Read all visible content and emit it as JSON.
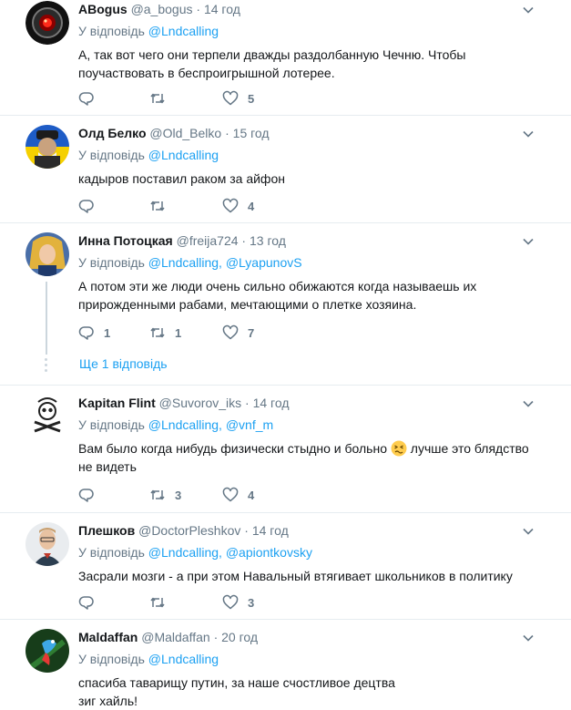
{
  "colors": {
    "link": "#1da1f2",
    "muted": "#657786",
    "text": "#14171a",
    "border": "#e6ecf0"
  },
  "tweets": [
    {
      "fullname": "ABogus",
      "username": "@a_bogus",
      "time": "14 год",
      "reply_prefix": "У відповідь",
      "reply_to": [
        "@Lndcalling"
      ],
      "text": "А, так вот чего они терпели дважды раздолбанную Чечню. Чтобы поучаствовать в беспроигрышной лотерее.",
      "replies": "",
      "retweets": "",
      "likes": "5"
    },
    {
      "fullname": "Олд Белко",
      "username": "@Old_Belko",
      "time": "15 год",
      "reply_prefix": "У відповідь",
      "reply_to": [
        "@Lndcalling"
      ],
      "text": "кадыров поставил раком за айфон",
      "replies": "",
      "retweets": "",
      "likes": "4"
    },
    {
      "fullname": "Инна Потоцкая",
      "username": "@freija724",
      "time": "13 год",
      "reply_prefix": "У відповідь",
      "reply_to": [
        "@Lndcalling",
        "@LyapunovS"
      ],
      "text": "А потом эти же люди очень сильно обижаются когда называешь их прирожденными рабами, мечтающими о плетке хозяина.",
      "replies": "1",
      "retweets": "1",
      "likes": "7",
      "show_replies": "Ще 1 відповідь"
    },
    {
      "fullname": "Kapitan Flint",
      "username": "@Suvorov_iks",
      "time": "14 год",
      "reply_prefix": "У відповідь",
      "reply_to": [
        "@Lndcalling",
        "@vnf_m"
      ],
      "text_before_emoji": "Вам было когда нибудь физически стыдно и больно",
      "emoji": "persevering-face-emoji",
      "text_after_emoji": "лучше это блядство не видеть",
      "replies": "",
      "retweets": "3",
      "likes": "4"
    },
    {
      "fullname": "Плешков",
      "username": "@DoctorPleshkov",
      "time": "14 год",
      "reply_prefix": "У відповідь",
      "reply_to": [
        "@Lndcalling",
        "@apiontkovsky"
      ],
      "text": "Засрали мозги - а при этом Навальный втягивает школьников в политику",
      "replies": "",
      "retweets": "",
      "likes": "3"
    },
    {
      "fullname": "Maldaffan",
      "username": "@Maldaffan",
      "time": "20 год",
      "reply_prefix": "У відповідь",
      "reply_to": [
        "@Lndcalling"
      ],
      "text_lines": [
        "спасиба таварищу путин, за наше счостливое децтва",
        "зиг хайль!"
      ]
    }
  ],
  "icons": {
    "reply": "reply-icon",
    "retweet": "retweet-icon",
    "like": "heart-icon",
    "menu": "chevron-down-icon"
  }
}
